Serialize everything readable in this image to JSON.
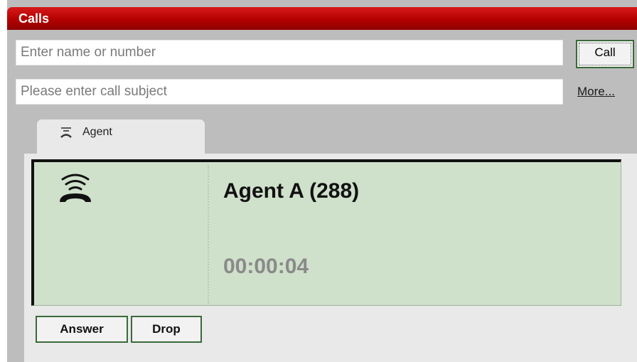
{
  "header": {
    "title": "Calls"
  },
  "dial": {
    "number_placeholder": "Enter name or number",
    "subject_placeholder": "Please enter call subject",
    "call_label": "Call",
    "more_label": "More..."
  },
  "tabs": [
    {
      "label": "Agent",
      "icon": "agent-icon",
      "selected": true
    }
  ],
  "call": {
    "state_icon": "ringing-phone-icon",
    "caller": "Agent A (288)",
    "duration": "00:00:04"
  },
  "actions": {
    "answer_label": "Answer",
    "drop_label": "Drop"
  },
  "colors": {
    "title_bar": "#b40000",
    "card_bg": "#cfe0cb",
    "button_border": "#3a6a3a"
  }
}
